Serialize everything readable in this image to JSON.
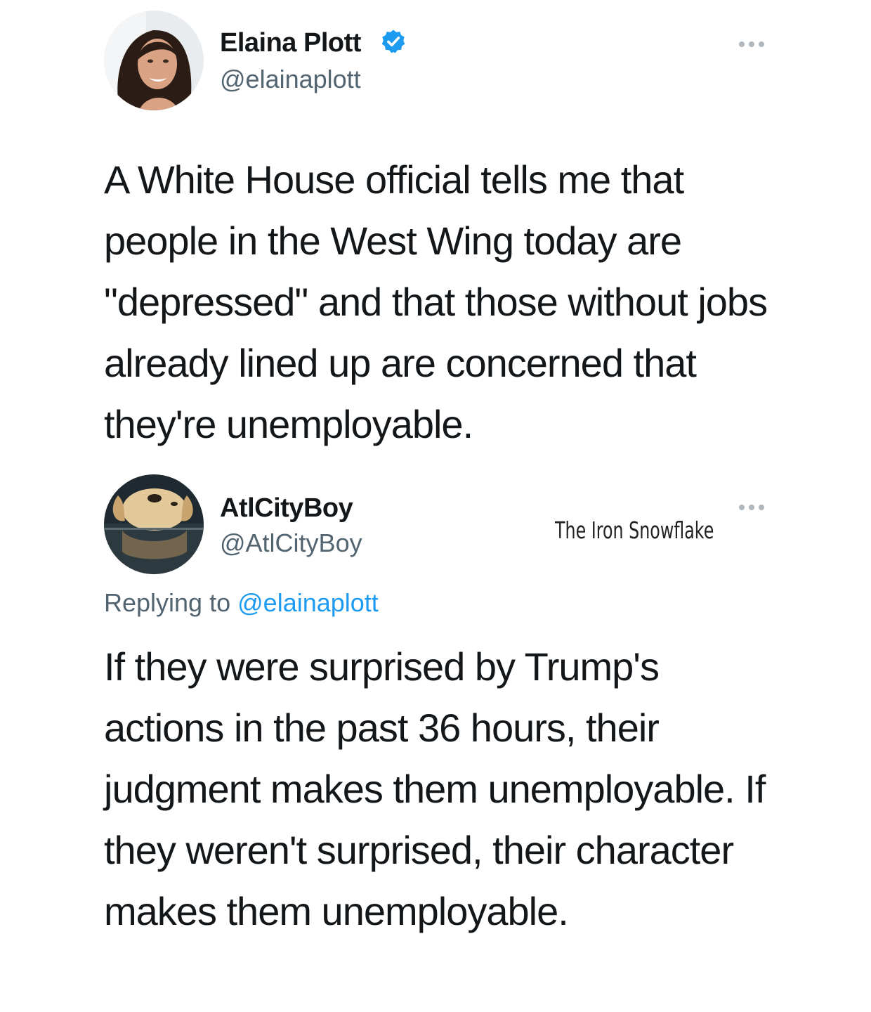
{
  "tweet": {
    "author_name": "Elaina Plott",
    "author_handle": "@elainaplott",
    "verified": true,
    "more_icon": "more-horizontal-icon",
    "text": "A White House official tells me that people in the West Wing today are \"depressed\" and that those without jobs already lined up are concerned that they're unemployable."
  },
  "reply": {
    "author_name": "AtlCityBoy",
    "author_handle": "@AtlCityBoy",
    "more_icon": "more-horizontal-icon",
    "replying_prefix": "Replying to",
    "replying_handle": "@elainaplott",
    "text": "If they were surprised by Trump's actions in the past 36 hours, their judgment makes them unemployable. If they weren't surprised, their character makes them unemployable."
  },
  "watermark": "The Iron Snowflake",
  "colors": {
    "text": "#14171a",
    "secondary": "#536471",
    "link": "#1d9bf0",
    "verified": "#1d9bf0"
  }
}
